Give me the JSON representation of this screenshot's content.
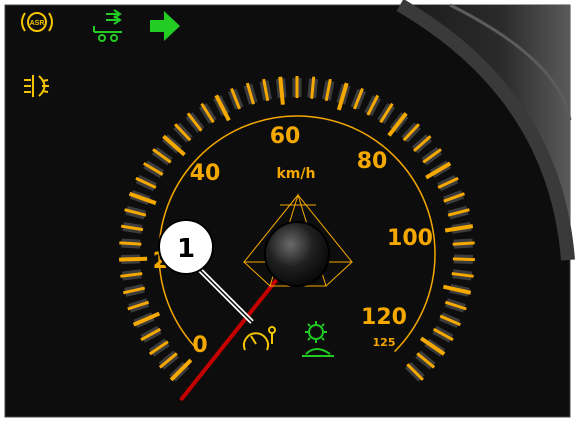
{
  "speedometer": {
    "unit": "km/h",
    "scale_labels": [
      "0",
      "20",
      "40",
      "60",
      "80",
      "100",
      "120"
    ],
    "secondary_label": "125",
    "needle_value_kmh": -3,
    "scale_color": "#f5a800",
    "needle_color": "#c40000"
  },
  "callout": {
    "number": "1"
  },
  "indicators": {
    "top_row": [
      "asr-warning-icon",
      "trailer-turn-signal-icon",
      "turn-signal-right-icon"
    ],
    "left_column": [
      "fog-light-icon"
    ],
    "bottom_row": [
      "cruise-control-icon",
      "hill-descent-icon"
    ],
    "amber": "#f5c400",
    "green": "#22cc22"
  },
  "asr_label": "ASR"
}
